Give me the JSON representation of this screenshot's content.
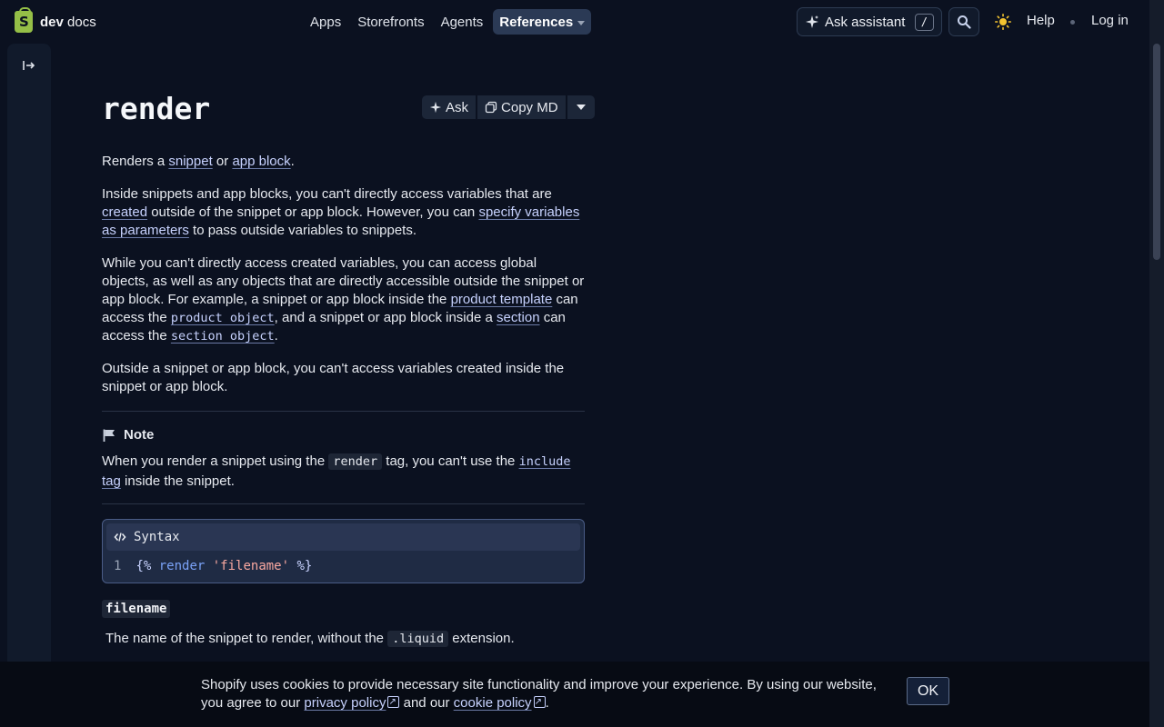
{
  "header": {
    "logo_bold": "dev",
    "logo_light": "docs",
    "nav": [
      "Apps",
      "Storefronts",
      "Agents",
      "References"
    ],
    "ask_assistant": "Ask assistant",
    "shortcut": "/",
    "help": "Help",
    "login": "Log in"
  },
  "page": {
    "title": "render",
    "actions": {
      "ask": "Ask",
      "copy_md": "Copy MD"
    },
    "intro": {
      "t1": "Renders a ",
      "snippet": "snippet",
      "t2": " or ",
      "app_block": "app block",
      "t3": "."
    },
    "para1": {
      "t1": "Inside snippets and app blocks, you can't directly access variables that are ",
      "created": "created",
      "t2": " outside of the snippet or app block. However, you can ",
      "specify": "specify variables as parameters",
      "t3": " to pass outside variables to snippets."
    },
    "para2": {
      "t1": "While you can't directly access created variables, you can access global objects, as well as any objects that are directly accessible outside the snippet or app block. For example, a snippet or app block inside the ",
      "product_template": "product template",
      "t2": " can access the ",
      "product_object": "product object",
      "t3": ", and a snippet or app block inside a ",
      "section": "section",
      "t4": " can access the ",
      "section_object": "section object",
      "t5": "."
    },
    "para3": "Outside a snippet or app block, you can't access variables created inside the snippet or app block.",
    "note": {
      "title": "Note",
      "t1": "When you render a snippet using the ",
      "code": "render",
      "t2": " tag, you can't use the ",
      "include_code": "include",
      "include_rest": " tag",
      "t3": " inside the snippet."
    },
    "syntax": {
      "label": "Syntax",
      "line_no": "1",
      "open": "{%",
      "keyword": "render",
      "string": "'filename'",
      "close": "%}"
    },
    "param": {
      "name": "filename",
      "t1": "The name of the snippet to render, without the ",
      "ext": ".liquid",
      "t2": " extension."
    }
  },
  "cookie": {
    "t1": "Shopify uses cookies to provide necessary site functionality and improve your experience. By using our website, you agree to our ",
    "privacy": "privacy policy",
    "t2": " and our ",
    "cookie_policy": "cookie policy",
    "t3": ".",
    "ok": "OK"
  },
  "colors": {
    "background": "#0b1120",
    "accent_link": "#c7d2fe",
    "logo_green": "#95bf47",
    "active_nav": "#2b3a55"
  },
  "icons": [
    "shopify-bag-icon",
    "caret-down-icon",
    "sparkle-icon",
    "search-icon",
    "sun-icon",
    "sidebar-toggle-icon",
    "copy-icon",
    "flag-icon",
    "code-icon",
    "external-link-icon"
  ]
}
